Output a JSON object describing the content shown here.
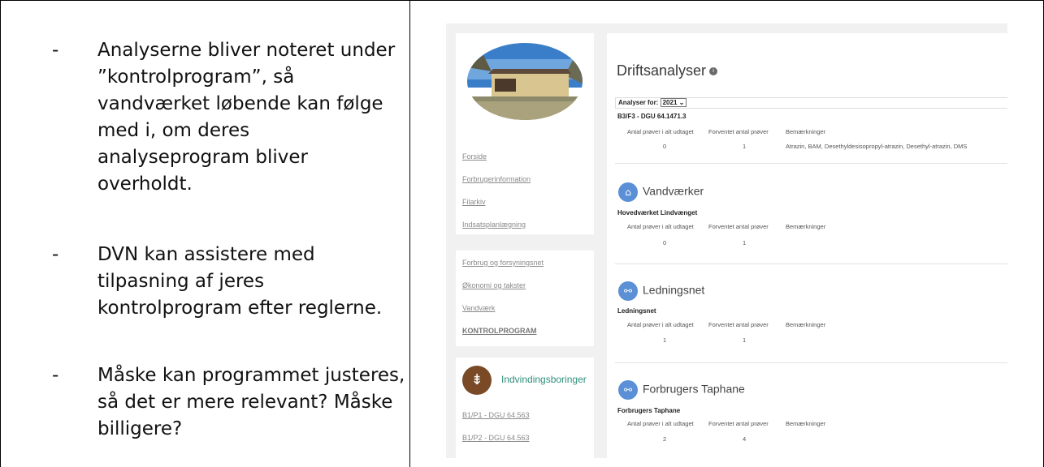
{
  "bullets": [
    {
      "dash": "-",
      "text": "Analyserne bliver noteret under ”kontrolprogram”, så vandværket løbende kan følge med i, om deres analyseprogram bliver overholdt."
    },
    {
      "dash": "-",
      "text": "DVN kan assistere med tilpasning af jeres kontrolprogram efter reglerne."
    },
    {
      "dash": "-",
      "text": "Måske kan programmet justeres, så det er mere relevant? Måske billigere?"
    }
  ],
  "sidebar": {
    "nav1": [
      "Forside",
      "Forbrugerinformation",
      "Filarkiv",
      "Indsatsplanlægning"
    ],
    "nav2": [
      "Forbrug og forsyningsnet",
      "Økonomi og takster",
      "Vandværk",
      "KONTROLPROGRAM"
    ],
    "borings_title": "Indvindingsboringer",
    "borings": [
      "B1/P1 - DGU 64.563",
      "B1/P2 - DGU 64.563"
    ]
  },
  "main": {
    "title": "Driftsanalyser",
    "info_icon": "i",
    "filter_label": "Analyser for:",
    "filter_value": "2021",
    "filter_chevron": "⌄",
    "col_headers": [
      "Antal prøver i alt udtaget",
      "Forventet antal prøver",
      "Bemærkninger"
    ],
    "top": {
      "name": "B3/F3 - DGU 64.1471.3",
      "taken": "0",
      "expected": "1",
      "remarks": "Atrazin, BAM, Desethyldesisopropyl-atrazin, Desethyl-atrazin, DMS"
    },
    "sections": [
      {
        "title": "Vandværker",
        "icon": "home-icon",
        "glyph": "⌂",
        "sub": "Hovedværket Lindvænget",
        "taken": "0",
        "expected": "1"
      },
      {
        "title": "Ledningsnet",
        "icon": "pipe-network-icon",
        "glyph": "⚯",
        "sub": "Ledningsnet",
        "taken": "1",
        "expected": "1"
      },
      {
        "title": "Forbrugers Taphane",
        "icon": "tap-icon",
        "glyph": "⚯",
        "sub": "Forbrugers Taphane",
        "taken": "2",
        "expected": "4"
      }
    ]
  },
  "colors": {
    "section_icon": "#5b8fd6",
    "boring_icon": "#7a4a27",
    "boring_title": "#2f8f7a"
  }
}
